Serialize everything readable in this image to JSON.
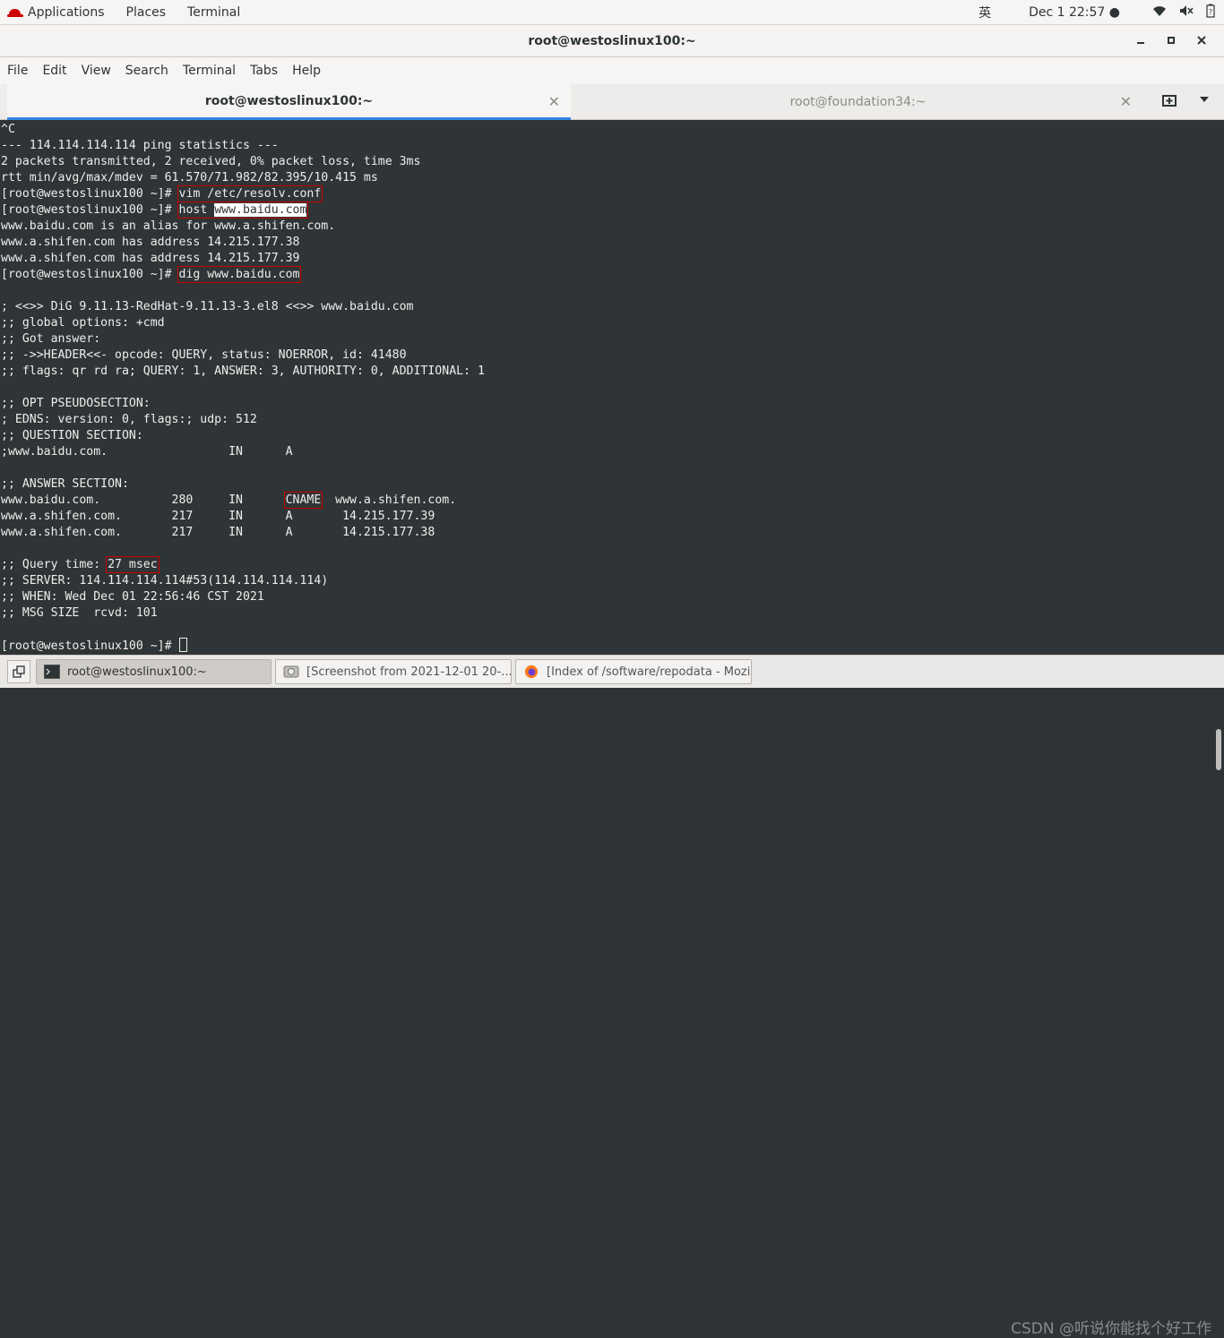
{
  "topbar": {
    "applications": "Applications",
    "places": "Places",
    "terminal": "Terminal",
    "input_method": "英",
    "datetime": "Dec 1  22:57 ●"
  },
  "window": {
    "title": "root@westoslinux100:~"
  },
  "menu": [
    "File",
    "Edit",
    "View",
    "Search",
    "Terminal",
    "Tabs",
    "Help"
  ],
  "tabs": [
    {
      "label": "root@westoslinux100:~",
      "active": true
    },
    {
      "label": "root@foundation34:~",
      "active": false
    }
  ],
  "terminal": {
    "prompt": "[root@westoslinux100 ~]# ",
    "lines": [
      "^C",
      "--- 114.114.114.114 ping statistics ---",
      "2 packets transmitted, 2 received, 0% packet loss, time 3ms",
      "rtt min/avg/max/mdev = 61.570/71.982/82.395/10.415 ms"
    ],
    "cmd_vim": "vim /etc/resolv.conf",
    "cmd_host_word": "host",
    "cmd_host_arg": "www.baidu.com",
    "host_out": [
      "www.baidu.com is an alias for www.a.shifen.com.",
      "www.a.shifen.com has address 14.215.177.38",
      "www.a.shifen.com has address 14.215.177.39"
    ],
    "cmd_dig": "dig www.baidu.com",
    "dig_out1": [
      "",
      "; <<>> DiG 9.11.13-RedHat-9.11.13-3.el8 <<>> www.baidu.com",
      ";; global options: +cmd",
      ";; Got answer:",
      ";; ->>HEADER<<- opcode: QUERY, status: NOERROR, id: 41480",
      ";; flags: qr rd ra; QUERY: 1, ANSWER: 3, AUTHORITY: 0, ADDITIONAL: 1",
      "",
      ";; OPT PSEUDOSECTION:",
      "; EDNS: version: 0, flags:; udp: 512",
      ";; QUESTION SECTION:",
      ";www.baidu.com.                 IN      A",
      "",
      ";; ANSWER SECTION:"
    ],
    "answer_pre": "www.baidu.com.          280     IN      ",
    "answer_type": "CNAME",
    "answer_post": "  www.a.shifen.com.",
    "dig_out2": [
      "www.a.shifen.com.       217     IN      A       14.215.177.39",
      "www.a.shifen.com.       217     IN      A       14.215.177.38",
      ""
    ],
    "query_label": ";; Query time: ",
    "query_value": "27 msec",
    "dig_out3": [
      ";; SERVER: 114.114.114.114#53(114.114.114.114)",
      ";; WHEN: Wed Dec 01 22:56:46 CST 2021",
      ";; MSG SIZE  rcvd: 101",
      ""
    ]
  },
  "taskbar": {
    "items": [
      {
        "label": "root@westoslinux100:~",
        "active": true
      },
      {
        "label": "[Screenshot from 2021-12-01 20-...",
        "active": false
      },
      {
        "label": "[Index of /software/repodata - Mozil...",
        "active": false
      }
    ],
    "watermark": "CSDN @听说你能找个好工作"
  },
  "colors": {
    "terminal_bg": "#2f3436",
    "terminal_fg": "#eeeeec",
    "highlight_box": "#cc0000",
    "tab_accent": "#3584e4"
  }
}
